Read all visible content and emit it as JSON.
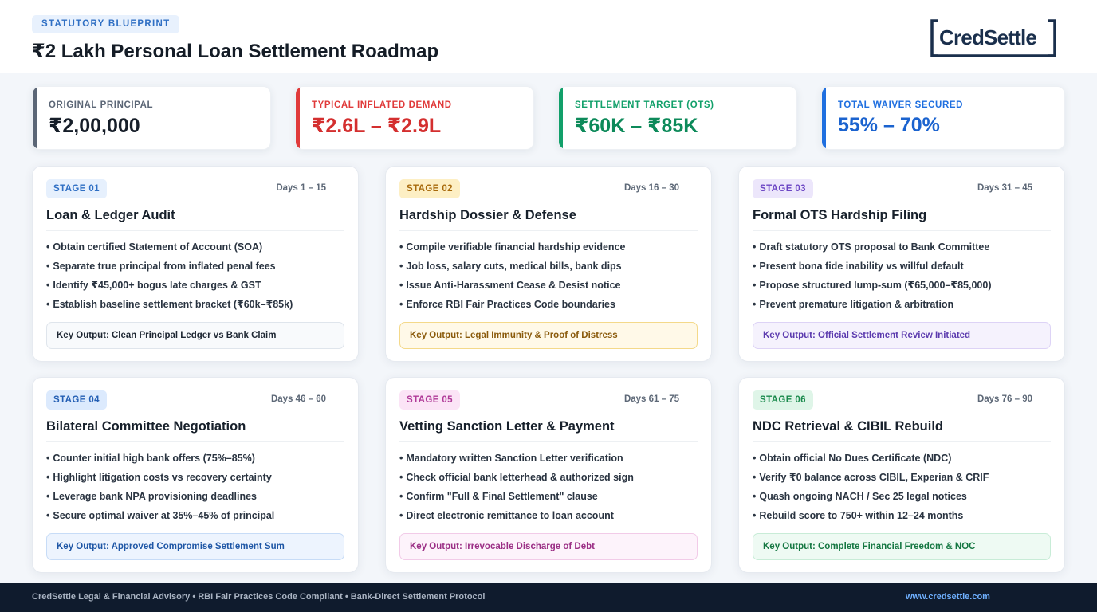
{
  "header": {
    "eyebrow": "STATUTORY BLUEPRINT",
    "title": "₹2 Lakh Personal Loan Settlement Roadmap",
    "logo_text": "CredSettle"
  },
  "stats": [
    {
      "label": "ORIGINAL PRINCIPAL",
      "value": "₹2,00,000",
      "color": "#5b6676",
      "value_color": "#161e29"
    },
    {
      "label": "TYPICAL INFLATED DEMAND",
      "value": "₹2.6L – ₹2.9L",
      "color": "#e03a3a",
      "value_color": "#d42f2f"
    },
    {
      "label": "SETTLEMENT TARGET (OTS)",
      "value": "₹60K – ₹85K",
      "color": "#12a06a",
      "value_color": "#0d8a5a"
    },
    {
      "label": "TOTAL WAIVER SECURED",
      "value": "55% – 70%",
      "color": "#1f6fe0",
      "value_color": "#1b63cf"
    }
  ],
  "stages": [
    {
      "badge": "STAGE 01",
      "days": "Days 1 – 15",
      "title": "Loan & Ledger Audit",
      "bullets": [
        "Obtain certified Statement of Account (SOA)",
        "Separate true principal from inflated penal fees",
        "Identify ₹45,000+ bogus late charges & GST",
        "Establish baseline settlement bracket (₹60k–₹85k)"
      ],
      "output": "Key Output: Clean Principal Ledger vs Bank Claim",
      "theme": "blue"
    },
    {
      "badge": "STAGE 02",
      "days": "Days 16 – 30",
      "title": "Hardship Dossier & Defense",
      "bullets": [
        "Compile verifiable financial hardship evidence",
        "Job loss, salary cuts, medical bills, bank dips",
        "Issue Anti-Harassment Cease & Desist notice",
        "Enforce RBI Fair Practices Code boundaries"
      ],
      "output": "Key Output: Legal Immunity & Proof of Distress",
      "theme": "amber"
    },
    {
      "badge": "STAGE 03",
      "days": "Days 31 – 45",
      "title": "Formal OTS Hardship Filing",
      "bullets": [
        "Draft statutory OTS proposal to Bank Committee",
        "Present bona fide inability vs willful default",
        "Propose structured lump-sum (₹65,000–₹85,000)",
        "Prevent premature litigation & arbitration"
      ],
      "output": "Key Output: Official Settlement Review Initiated",
      "theme": "purple"
    },
    {
      "badge": "STAGE 04",
      "days": "Days 46 – 60",
      "title": "Bilateral Committee Negotiation",
      "bullets": [
        "Counter initial high bank offers (75%–85%)",
        "Highlight litigation costs vs recovery certainty",
        "Leverage bank NPA provisioning deadlines",
        "Secure optimal waiver at 35%–45% of principal"
      ],
      "output": "Key Output: Approved Compromise Settlement Sum",
      "theme": "blue2"
    },
    {
      "badge": "STAGE 05",
      "days": "Days 61 – 75",
      "title": "Vetting Sanction Letter & Payment",
      "bullets": [
        "Mandatory written Sanction Letter verification",
        "Check official bank letterhead & authorized sign",
        "Confirm \"Full & Final Settlement\" clause",
        "Direct electronic remittance to loan account"
      ],
      "output": "Key Output: Irrevocable Discharge of Debt",
      "theme": "pink"
    },
    {
      "badge": "STAGE 06",
      "days": "Days 76 – 90",
      "title": "NDC Retrieval & CIBIL Rebuild",
      "bullets": [
        "Obtain official No Dues Certificate (NDC)",
        "Verify ₹0 balance across CIBIL, Experian & CRIF",
        "Quash ongoing NACH / Sec 25 legal notices",
        "Rebuild score to 750+ within 12–24 months"
      ],
      "output": "Key Output: Complete Financial Freedom & NOC",
      "theme": "green"
    }
  ],
  "themes": {
    "blue": {
      "badge_bg": "#e6f0fd",
      "badge_fg": "#2f6fc4",
      "box_bg": "#f8fafc",
      "box_border": "#dfe5ec",
      "box_fg": "#1e2733"
    },
    "amber": {
      "badge_bg": "#fdefc4",
      "badge_fg": "#a86a0c",
      "box_bg": "#fff9e8",
      "box_border": "#f4d98a",
      "box_fg": "#8a5a0b"
    },
    "purple": {
      "badge_bg": "#ece6fb",
      "badge_fg": "#6b45c4",
      "box_bg": "#f5f2fd",
      "box_border": "#ddd3f6",
      "box_fg": "#5b3aae"
    },
    "blue2": {
      "badge_bg": "#dceafd",
      "badge_fg": "#245fb4",
      "box_bg": "#edf4fe",
      "box_border": "#c7dcf7",
      "box_fg": "#1f57a6"
    },
    "pink": {
      "badge_bg": "#fbe4f6",
      "badge_fg": "#b03a98",
      "box_bg": "#fdf3fb",
      "box_border": "#f2cbe8",
      "box_fg": "#9b2f85"
    },
    "green": {
      "badge_bg": "#dff5e8",
      "badge_fg": "#1a8a4c",
      "box_bg": "#eefaf3",
      "box_border": "#c8ecd7",
      "box_fg": "#157742"
    }
  },
  "footer": {
    "text": "CredSettle Legal & Financial Advisory • RBI Fair Practices Code Compliant • Bank-Direct Settlement Protocol",
    "link": "www.credsettle.com"
  }
}
